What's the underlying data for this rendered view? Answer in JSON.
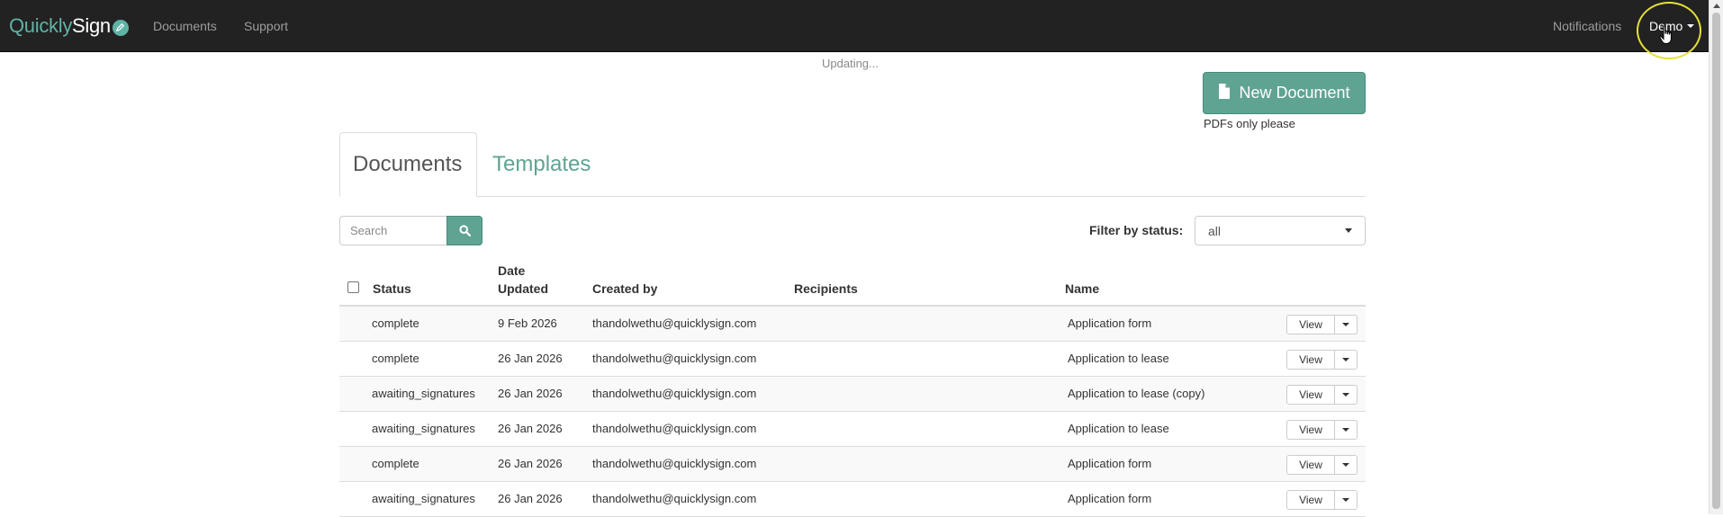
{
  "navbar": {
    "brand_part1": "Quickly",
    "brand_part2": "Sign",
    "links": [
      "Documents",
      "Support"
    ],
    "notifications": "Notifications",
    "user": "Demo"
  },
  "status_text": "Updating...",
  "new_document": {
    "label": "New Document",
    "note": "PDFs only please"
  },
  "tabs": [
    "Documents",
    "Templates"
  ],
  "search": {
    "placeholder": "Search"
  },
  "filter": {
    "label": "Filter by status:",
    "selected": "all"
  },
  "table": {
    "headers": {
      "status": "Status",
      "date_line1": "Date",
      "date_line2": "Updated",
      "created_by": "Created by",
      "recipients": "Recipients",
      "name": "Name"
    },
    "view_label": "View",
    "rows": [
      {
        "status": "complete",
        "date": "9 Feb 2026",
        "created_by": "thandolwethu@quicklysign.com",
        "recipients": "",
        "name": "Application form"
      },
      {
        "status": "complete",
        "date": "26 Jan 2026",
        "created_by": "thandolwethu@quicklysign.com",
        "recipients": "",
        "name": "Application to lease"
      },
      {
        "status": "awaiting_signatures",
        "date": "26 Jan 2026",
        "created_by": "thandolwethu@quicklysign.com",
        "recipients": "",
        "name": "Application to lease (copy)"
      },
      {
        "status": "awaiting_signatures",
        "date": "26 Jan 2026",
        "created_by": "thandolwethu@quicklysign.com",
        "recipients": "",
        "name": "Application to lease"
      },
      {
        "status": "complete",
        "date": "26 Jan 2026",
        "created_by": "thandolwethu@quicklysign.com",
        "recipients": "",
        "name": "Application form"
      },
      {
        "status": "awaiting_signatures",
        "date": "26 Jan 2026",
        "created_by": "thandolwethu@quicklysign.com",
        "recipients": "",
        "name": "Application form"
      }
    ]
  },
  "colors": {
    "navbar_bg": "#222222",
    "accent": "#5fa393",
    "brand_accent": "#5fb3a6",
    "highlight_ring": "#e6e03a"
  },
  "icons": {
    "logo": "pen-circle-icon",
    "new_document": "file-icon",
    "search": "search-icon",
    "dropdown": "caret-down-icon",
    "cursor": "hand-pointer-icon"
  }
}
